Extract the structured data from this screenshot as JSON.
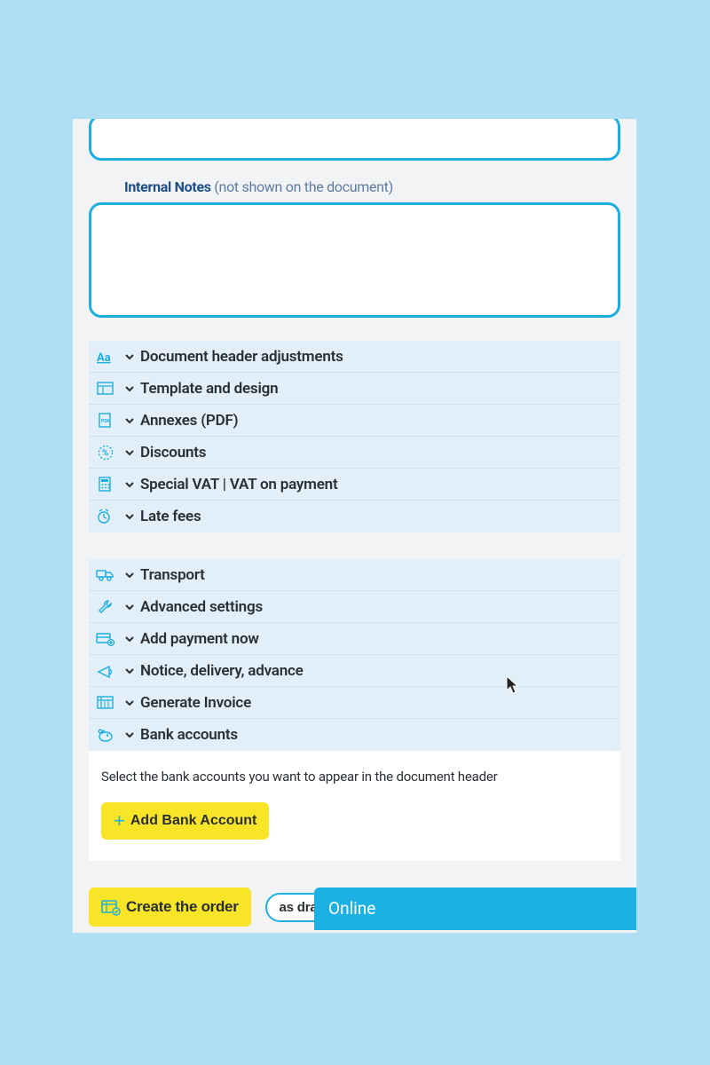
{
  "notes": {
    "label": "Internal Notes",
    "hint": "(not shown on the document)",
    "value": ""
  },
  "groups": [
    {
      "rows": [
        {
          "icon": "Aa",
          "label": "Document header adjustments"
        },
        {
          "icon": "template",
          "label": "Template and design"
        },
        {
          "icon": "pdf",
          "label": "Annexes (PDF)"
        },
        {
          "icon": "discount",
          "label": "Discounts"
        },
        {
          "icon": "vat",
          "label": "Special VAT | VAT on payment"
        },
        {
          "icon": "latefee",
          "label": "Late fees"
        }
      ]
    },
    {
      "rows": [
        {
          "icon": "transport",
          "label": "Transport"
        },
        {
          "icon": "wrench",
          "label": "Advanced settings"
        },
        {
          "icon": "paynow",
          "label": "Add payment now"
        },
        {
          "icon": "notice",
          "label": "Notice, delivery, advance"
        },
        {
          "icon": "invoice",
          "label": "Generate Invoice"
        },
        {
          "icon": "bank",
          "label": "Bank accounts",
          "expanded": true
        }
      ]
    }
  ],
  "bank": {
    "hint": "Select the bank accounts you want to appear in the document header",
    "add_label": "Add Bank Account"
  },
  "footer": {
    "create_label": "Create the order",
    "draft_label": "as draft",
    "online_label": "Online"
  }
}
